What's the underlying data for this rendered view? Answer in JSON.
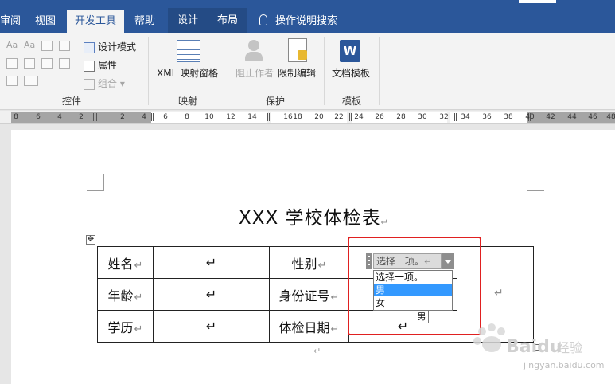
{
  "ribbon_tabs": [
    {
      "label": "审阅"
    },
    {
      "label": "视图"
    },
    {
      "label": "开发工具"
    },
    {
      "label": "帮助"
    },
    {
      "label": "设计"
    },
    {
      "label": "布局"
    }
  ],
  "tell_me": "操作说明搜索",
  "groups": {
    "controls": {
      "label": "控件",
      "design_mode": "设计模式",
      "properties": "属性",
      "group": "组合"
    },
    "mapping": {
      "label": "映射",
      "xml_pane": "XML 映射窗格"
    },
    "protect": {
      "label": "保护",
      "block_authors": "阻止作者",
      "restrict_editing": "限制编辑"
    },
    "templates": {
      "label": "模板",
      "doc_template": "文档模板"
    }
  },
  "ruler_numbers": [
    "8",
    "6",
    "4",
    "2",
    "2",
    "4",
    "6",
    "8",
    "10",
    "12",
    "14",
    "16",
    "18",
    "20",
    "22",
    "24",
    "26",
    "28",
    "30",
    "32",
    "34",
    "36",
    "38",
    "40",
    "42",
    "44",
    "46",
    "48"
  ],
  "document": {
    "title": "XXX 学校体检表",
    "paragraph_mark": "↵",
    "rows": [
      {
        "label1": "姓名",
        "label2": "性别"
      },
      {
        "label1": "年龄",
        "label2": "身份证号"
      },
      {
        "label1": "学历",
        "label2": "体检日期"
      }
    ]
  },
  "content_control": {
    "placeholder": "选择一项。",
    "options": [
      "选择一项。",
      "男",
      "女"
    ],
    "selected": "男",
    "tooltip": "男"
  },
  "watermark": {
    "text": "jingyan.baidu.com"
  },
  "colors": {
    "ribbon_blue": "#2b579a",
    "highlight": "#3399ff",
    "callout_red": "#e02020"
  }
}
